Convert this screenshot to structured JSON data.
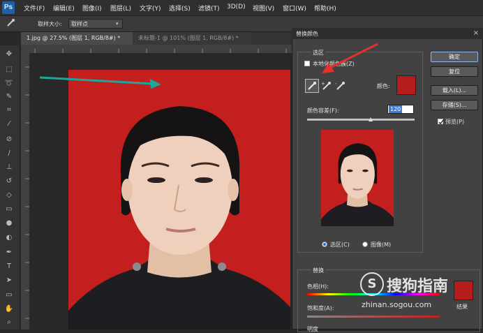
{
  "app": {
    "logo": "Ps"
  },
  "menu": [
    "文件(F)",
    "编辑(E)",
    "图像(I)",
    "图层(L)",
    "文字(Y)",
    "选择(S)",
    "滤镜(T)",
    "3D(D)",
    "视图(V)",
    "窗口(W)",
    "帮助(H)"
  ],
  "options": {
    "sample_size_label": "取样大小:",
    "sample_size_value": "取样点"
  },
  "tabs": [
    {
      "label": "1.jpg @ 27.5% (图层 1, RGB/8#) *",
      "close": "×"
    },
    {
      "label": "未标题-1 @ 101% (图层 1, RGB/8#) *",
      "close": "×"
    }
  ],
  "dialog": {
    "title": "替换颜色",
    "selection": {
      "group_label": "选区",
      "localized_label": "本地化颜色簇(Z)",
      "color_label": "颜色:",
      "color_value": "#b71c1c",
      "fuzziness_label": "颜色容差(F):",
      "fuzziness_value": "120",
      "radio_selection": "选区(C)",
      "radio_image": "图像(M)"
    },
    "buttons": {
      "ok": "确定",
      "reset": "复位",
      "load": "载入(L)...",
      "save": "存储(S)...",
      "preview": "预览(P)"
    },
    "replacement": {
      "group_label": "替换",
      "hue_label": "色相(H):",
      "saturation_label": "饱和度(A):",
      "lightness_label": "明度",
      "result_label": "结果",
      "result_color": "#b71c1c"
    }
  },
  "watermark": {
    "brand": "搜狗指南",
    "url": "zhinan.sogou.com"
  },
  "colors": {
    "accent_arrow": "#19a89a",
    "pointer_arrow": "#e8302a",
    "photo_bg": "#c41f1f"
  }
}
